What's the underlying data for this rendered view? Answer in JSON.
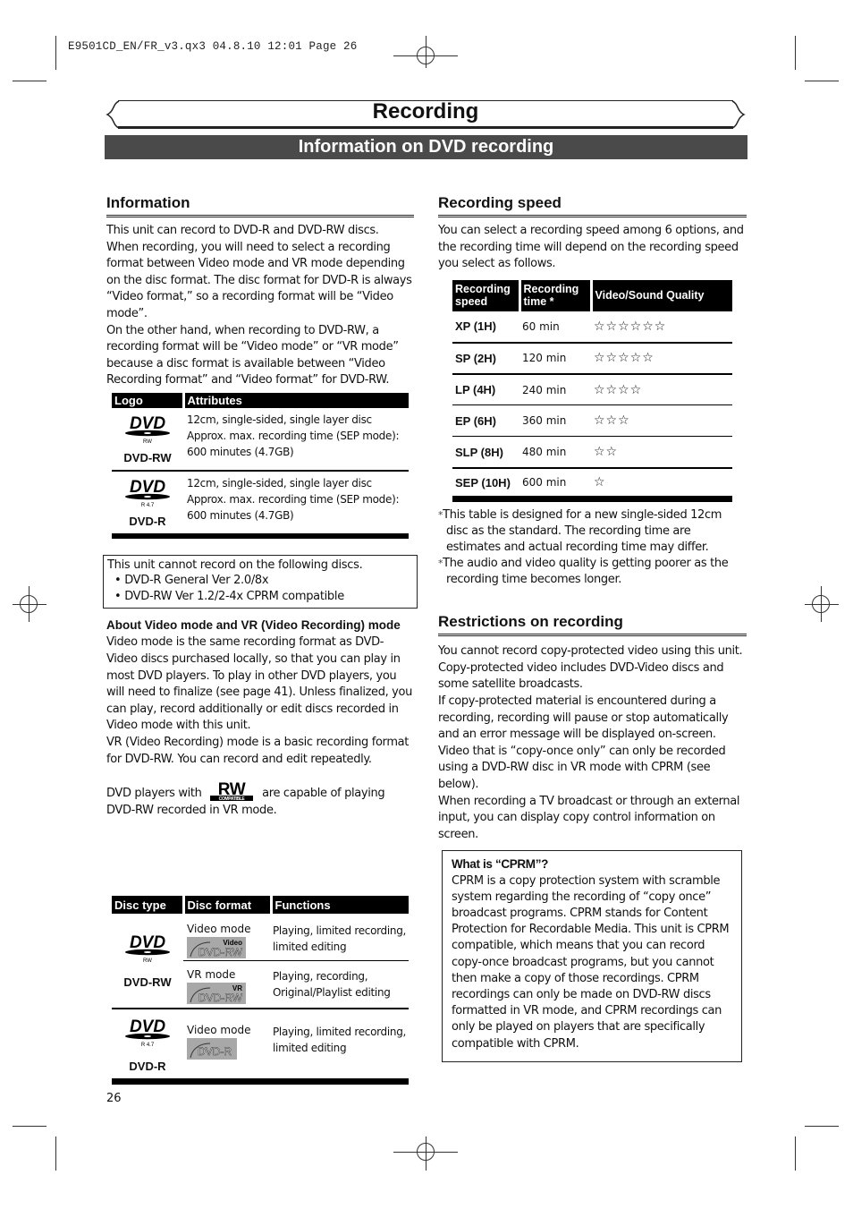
{
  "print_slug": "E9501CD_EN/FR_v3.qx3   04.8.10   12:01   Page 26",
  "header": {
    "title": "Recording",
    "subtitle": "Information on DVD recording"
  },
  "information": {
    "heading": "Information",
    "paragraphs": [
      "This unit can record to DVD-R and DVD-RW discs. When recording, you will need to select a recording format between Video mode and VR mode depending on the disc format. The disc format for DVD-R is always “Video format,” so a recording format will be “Video mode”.",
      "On the other hand, when recording to DVD-RW, a recording format will be “Video mode” or “VR mode” because a disc format is available between “Video Recording format” and “Video format” for DVD-RW."
    ],
    "logo_table": {
      "headers": [
        "Logo",
        "Attributes"
      ],
      "rows": [
        {
          "logo_icon": "dvd-rw-logo-icon",
          "logo_sub": "RW",
          "label": "DVD-RW",
          "attributes": [
            "12cm, single-sided, single layer disc",
            "Approx. max. recording time (SEP mode):",
            "600 minutes (4.7GB)"
          ]
        },
        {
          "logo_icon": "dvd-r-logo-icon",
          "logo_sub": "R 4.7",
          "label": "DVD-R",
          "attributes": [
            "12cm, single-sided, single layer disc",
            "Approx. max. recording time (SEP mode):",
            "600 minutes (4.7GB)"
          ]
        }
      ]
    },
    "notice": {
      "intro": "This unit cannot record on the following discs.",
      "items": [
        "• DVD-R General Ver 2.0/8x",
        "• DVD-RW Ver 1.2/2-4x CPRM compatible"
      ]
    },
    "about": {
      "heading": "About Video mode and VR (Video Recording) mode",
      "paragraphs": [
        "Video mode is the same recording format as DVD-Video discs purchased locally, so that you can play in most DVD players. To play in other DVD players, you will need to finalize (see page 41). Unless finalized, you can play, record additionally or edit discs recorded in Video mode with this unit.",
        "VR (Video Recording) mode is a basic recording format for DVD-RW. You can record and edit repeatedly."
      ],
      "rw_sentence_before": "DVD players with",
      "rw_logo_big": "RW",
      "rw_logo_small": "COMPATIBLE",
      "rw_sentence_after": "are capable of playing DVD-RW recorded in VR mode."
    },
    "disc_table": {
      "headers": [
        "Disc type",
        "Disc format",
        "Functions"
      ],
      "rows": [
        {
          "disc": "DVD-RW",
          "logo_sub": "RW",
          "formats": [
            {
              "mode": "Video mode",
              "badge_top": "Video",
              "badge_main": "DVD-RW",
              "functions": "Playing, limited recording, limited editing"
            },
            {
              "mode": "VR mode",
              "badge_top": "VR",
              "badge_main": "DVD-RW",
              "functions": "Playing, recording, Original/Playlist editing"
            }
          ]
        },
        {
          "disc": "DVD-R",
          "logo_sub": "R 4.7",
          "formats": [
            {
              "mode": "Video mode",
              "badge_top": "",
              "badge_main": "DVD-R",
              "functions": "Playing, limited recording, limited editing"
            }
          ]
        }
      ]
    }
  },
  "recording_speed": {
    "heading": "Recording speed",
    "intro": "You can select a recording speed among 6 options, and the recording time will depend on the recording speed you select as follows.",
    "table": {
      "headers": [
        "Recording speed",
        "Recording time *",
        "Video/Sound Quality"
      ],
      "rows": [
        {
          "speed": "XP (1H)",
          "time": "60 min",
          "stars": "☆☆☆☆☆☆",
          "quality": 6
        },
        {
          "speed": "SP (2H)",
          "time": "120 min",
          "stars": "☆☆☆☆☆",
          "quality": 5
        },
        {
          "speed": "LP (4H)",
          "time": "240 min",
          "stars": "☆☆☆☆",
          "quality": 4
        },
        {
          "speed": "EP (6H)",
          "time": "360 min",
          "stars": "☆☆☆",
          "quality": 3
        },
        {
          "speed": "SLP (8H)",
          "time": "480 min",
          "stars": "☆☆",
          "quality": 2
        },
        {
          "speed": "SEP (10H)",
          "time": "600 min",
          "stars": "☆",
          "quality": 1
        }
      ]
    },
    "footnotes": [
      "This table is designed for a new single-sided 12cm disc as the standard. The recording time are estimates and actual recording time may differ.",
      "The audio and video quality is getting poorer as the recording time becomes longer."
    ],
    "footnote_marker": "*"
  },
  "restrictions": {
    "heading": "Restrictions on recording",
    "paragraphs": [
      "You cannot record copy-protected video using this unit. Copy-protected video includes DVD-Video discs and some satellite broadcasts.",
      "If copy-protected material is encountered during a recording, recording will pause or stop automatically and an error message will be displayed on-screen.",
      "Video that is “copy-once only” can only be recorded using a DVD-RW disc in VR mode with CPRM (see below).",
      "When recording a TV broadcast or through an external input, you can display copy control information on screen."
    ],
    "cprm": {
      "heading": "What is “CPRM”?",
      "text": "CPRM is a copy protection system with scramble system regarding the recording of “copy once” broadcast programs. CPRM stands for Content Protection for Recordable Media. This unit is CPRM compatible, which means that you can  record copy-once broadcast programs, but you cannot then make a copy of those recordings. CPRM recordings can only be made on DVD-RW discs formatted in VR mode, and CPRM recordings can only be played on players that are specifically compatible with CPRM."
    }
  },
  "page_number": "26"
}
